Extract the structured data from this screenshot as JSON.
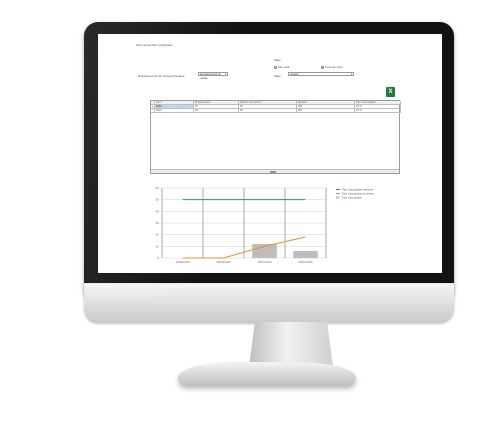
{
  "colors": {
    "accent_green": "#1b9a74",
    "accent_orange": "#f28c28",
    "bar_gray": "#bdbdbd",
    "excel_green": "#1e7d3a"
  },
  "filters": {
    "entity_label": "Sous-ensembles physiques",
    "location_label": "Emplacements du niveau physique",
    "location_value": "Emplacements du niveau",
    "site_label": "Sites",
    "site_value": "Largeur",
    "radio_options": [
      {
        "label": "Site actif",
        "selected": true
      },
      {
        "label": "Tous les sites",
        "selected": false
      }
    ]
  },
  "export_icon": "excel-icon",
  "grid": {
    "columns": [
      "Nom",
      "Emplacement",
      "Espace consommé",
      "Restant",
      "Taux d'occupation"
    ],
    "rows": [
      [
        "2020",
        "30",
        "94",
        "298",
        "24 %"
      ],
      [
        "2019",
        "29",
        "96",
        "301",
        "23 %"
      ]
    ]
  },
  "chart_data": {
    "type": "line",
    "categories": [
      "10/06/2019",
      "26/06/2019",
      "10/07/2019",
      "26/07/2019"
    ],
    "ylim": [
      0,
      60
    ],
    "yticks": [
      0,
      10,
      20,
      30,
      40,
      50,
      60
    ],
    "series": [
      {
        "kind": "line",
        "color": "#1b9a74",
        "values": [
          50,
          50,
          50,
          50
        ]
      },
      {
        "kind": "line",
        "color": "#f28c28",
        "values": [
          0,
          0,
          10,
          18
        ]
      },
      {
        "kind": "bar",
        "color": "#bdbdbd",
        "values": [
          0,
          0,
          12,
          6
        ]
      }
    ],
    "legend_entries": [
      "Taux d'occupation maximum",
      "Taux d'occupation du niveau",
      "Taux d'occupation"
    ],
    "legend_position": "top-right",
    "grid": true
  }
}
